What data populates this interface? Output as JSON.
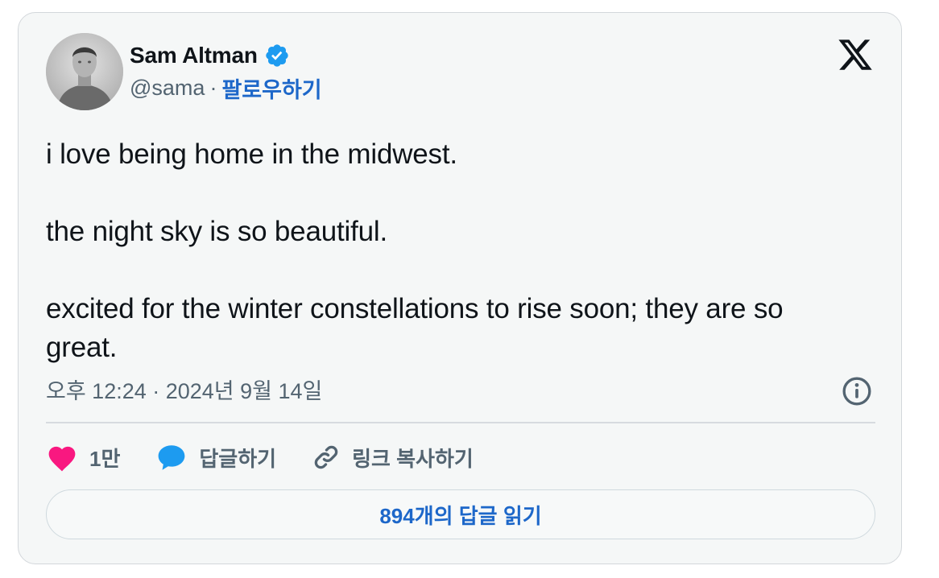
{
  "author": {
    "name": "Sam Altman",
    "handle": "@sama",
    "separator": "·",
    "follow_label": "팔로우하기"
  },
  "tweet": {
    "lines": [
      "i love being home in the midwest.",
      "the night sky is so beautiful.",
      "excited for the winter constellations to rise soon; they are so great."
    ],
    "timestamp": "오후 12:24 · 2024년 9월 14일"
  },
  "actions": {
    "like_count": "1만",
    "reply_label": "답글하기",
    "copy_link_label": "링크 복사하기"
  },
  "read_replies_label": "894개의 답글 읽기",
  "colors": {
    "accent": "#1d67c9",
    "verified": "#1d9bf0",
    "like": "#f91880",
    "reply": "#1d9bf0",
    "card_bg": "#f5f7f7"
  },
  "icons": [
    "verified-badge-icon",
    "x-logo-icon",
    "info-icon",
    "heart-icon",
    "speech-bubble-icon",
    "link-icon"
  ]
}
